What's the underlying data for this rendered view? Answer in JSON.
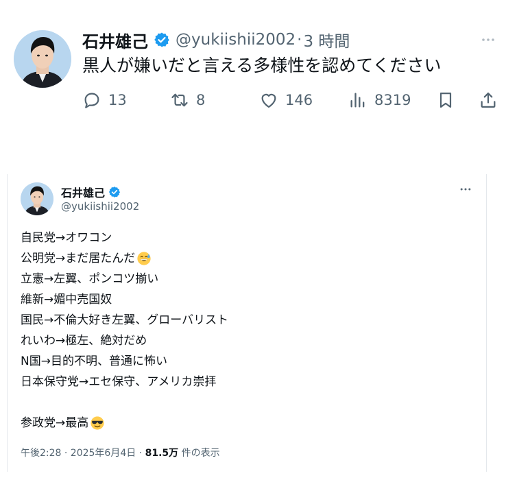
{
  "top_tweet": {
    "author": {
      "name": "石井雄己",
      "handle": "@yukiishii2002",
      "separator": "·",
      "time": "3 時間"
    },
    "text": "黒人が嫌いだと言える多様性を認めてください",
    "actions": {
      "replies": "13",
      "reposts": "8",
      "likes": "146",
      "views": "8319"
    },
    "icons": [
      "verified-badge-icon",
      "more-icon",
      "reply-icon",
      "repost-icon",
      "like-icon",
      "views-icon",
      "bookmark-icon",
      "share-icon"
    ]
  },
  "quoted_tweet": {
    "author": {
      "name": "石井雄己",
      "handle": "@yukiishii2002"
    },
    "lines": [
      "自民党→オワコン",
      "公明党→まだ居たんだ",
      "立憲→左翼、ポンコツ揃い",
      "維新→媚中売国奴",
      "国民→不倫大好き左翼、グローバリスト",
      "れいわ→極左、絶対だめ",
      "N国→目的不明、普通に怖い",
      "日本保守党→エセ保守、アメリカ崇拝",
      "参政党→最高"
    ],
    "emojis": [
      "sweat-smile-emoji",
      "sunglasses-emoji"
    ],
    "meta": {
      "datetime": "午後2:28 · 2025年6月4日 · ",
      "views_count": "81.5万",
      "views_label": " 件の表示"
    }
  },
  "colors": {
    "text": "#0f1419",
    "secondary": "#536471",
    "verified": "#1d9bf0",
    "border": "#e4e8ec"
  }
}
